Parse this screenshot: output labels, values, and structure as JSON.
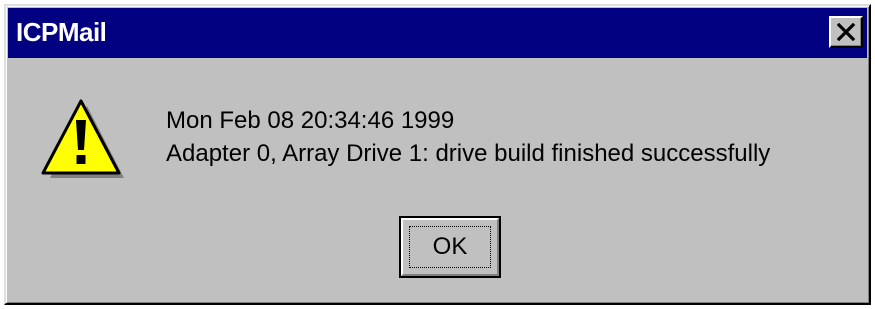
{
  "window": {
    "title": "ICPMail",
    "close_glyph": "✕",
    "title_bar_color": "#000080",
    "face_color": "#c0c0c0"
  },
  "icon": {
    "name": "warning-icon",
    "glyph": "!",
    "color": "#ffff00"
  },
  "message": {
    "line1": "Mon Feb 08 20:34:46 1999",
    "line2": "Adapter 0, Array Drive 1: drive build finished successfully"
  },
  "buttons": {
    "ok_label": "OK"
  }
}
